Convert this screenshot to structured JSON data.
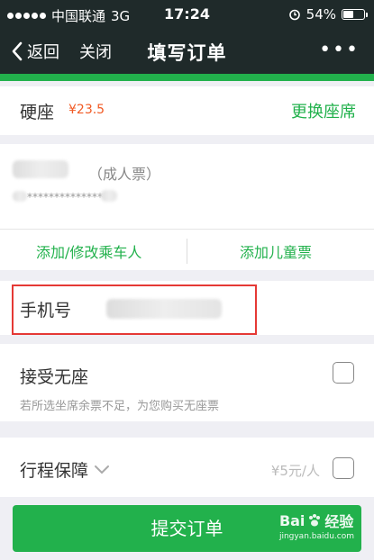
{
  "status_bar": {
    "carrier": "中国联通",
    "network": "3G",
    "time": "17:24",
    "battery": "54%",
    "battery_level": 0.54
  },
  "nav": {
    "back_label": "返回",
    "close_label": "关闭",
    "title": "填写订单",
    "more_label": "•••"
  },
  "seat": {
    "type": "硬座",
    "price": "¥23.5",
    "change_label": "更换座席"
  },
  "passenger": {
    "ticket_type": "（成人票）",
    "id_masked": "**************",
    "edit_label": "添加/修改乘车人",
    "add_child_label": "添加儿童票"
  },
  "phone": {
    "label": "手机号"
  },
  "no_seat": {
    "title": "接受无座",
    "description": "若所选坐席余票不足，为您购买无座票"
  },
  "insurance": {
    "title": "行程保障",
    "price": "¥5元/人"
  },
  "submit": {
    "label": "提交订单"
  },
  "watermark": {
    "brand": "Bai",
    "brand_suffix": "经验",
    "url": "jingyan.baidu.com"
  },
  "colors": {
    "accent": "#22b14c",
    "price": "#f15a24",
    "header": "#1f2a2a",
    "highlight": "#e53935"
  }
}
